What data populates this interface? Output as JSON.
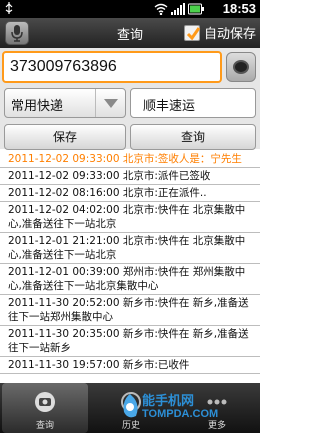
{
  "status_bar": {
    "time": "18:53"
  },
  "title_bar": {
    "title": "查询",
    "auto_save_label": "自动保存",
    "auto_save_checked": true
  },
  "form": {
    "tracking_number": "373009763896",
    "courier_type": "常用快递",
    "company": "顺丰速运",
    "save_label": "保存",
    "query_label": "查询"
  },
  "history": [
    "2011-12-02 09:33:00 北京市:签收人是：宁先生",
    "2011-12-02 09:33:00 北京市:派件已签收",
    "2011-12-02 08:16:00 北京市:正在派件..",
    "2011-12-02 04:02:00 北京市:快件在 北京集散中心,准备送往下一站北京",
    "2011-12-01 21:21:00 北京市:快件在 北京集散中心,准备送往下一站北京",
    "2011-12-01 00:39:00 郑州市:快件在 郑州集散中心,准备送往下一站北京集散中心",
    "2011-11-30 20:52:00 新乡市:快件在 新乡,准备送往下一站郑州集散中心",
    "2011-11-30 20:35:00 新乡市:快件在 新乡,准备送往下一站新乡",
    "2011-11-30 19:57:00 新乡市:已收件"
  ],
  "tabs": [
    {
      "label": "查询"
    },
    {
      "label": "历史"
    },
    {
      "label": "更多"
    }
  ],
  "watermark": {
    "cn": "能手机网",
    "en": "TOMPDA.COM"
  },
  "colors": {
    "accent": "#ff9a1a",
    "highlight_text": "#ff7f00"
  }
}
